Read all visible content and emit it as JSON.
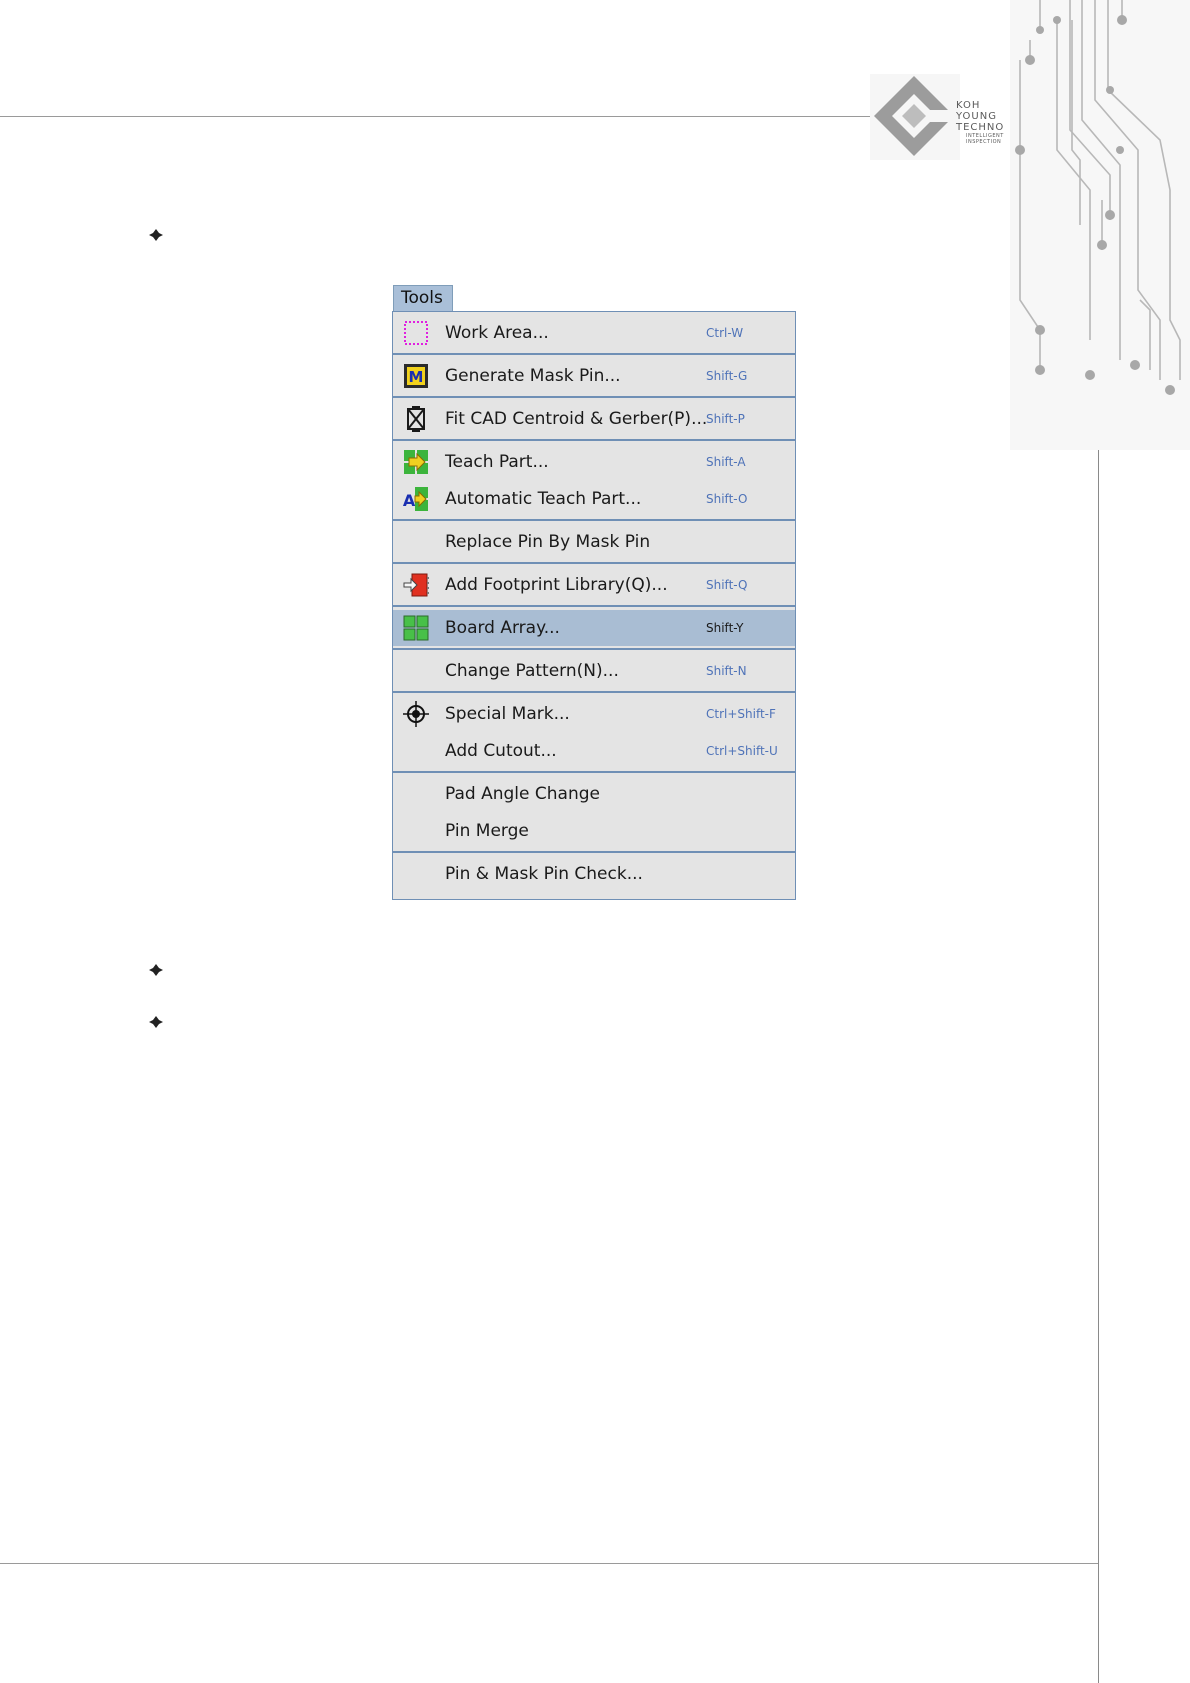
{
  "logo": {
    "line1": "KOH",
    "line2": "YOUNG",
    "line3": "TECHNO",
    "line4": "INTELLIGENT",
    "line5": "INSPECTION"
  },
  "menu": {
    "title": "Tools",
    "title_underline": "T",
    "items": [
      {
        "label": "Work Area...",
        "shortcut": "Ctrl-W",
        "icon": "work-area-icon"
      },
      {
        "label": "Generate Mask Pin...",
        "shortcut": "Shift-G",
        "icon": "mask-pin-icon"
      },
      {
        "label": "Fit CAD Centroid & Gerber(P)...",
        "shortcut": "Shift-P",
        "icon": "fit-cad-icon"
      },
      {
        "label": "Teach Part...",
        "shortcut": "Shift-A",
        "icon": "teach-part-icon"
      },
      {
        "label": "Automatic Teach Part...",
        "shortcut": "Shift-O",
        "icon": "auto-teach-icon"
      },
      {
        "label": "Replace Pin By Mask Pin",
        "shortcut": "",
        "icon": ""
      },
      {
        "label": "Add Footprint Library(Q)...",
        "shortcut": "Shift-Q",
        "icon": "footprint-library-icon"
      },
      {
        "label": "Board Array...",
        "shortcut": "Shift-Y",
        "icon": "board-array-icon",
        "highlighted": true
      },
      {
        "label": "Change Pattern(N)...",
        "shortcut": "Shift-N",
        "icon": ""
      },
      {
        "label": "Special Mark...",
        "shortcut": "Ctrl+Shift-F",
        "icon": "crosshair-icon"
      },
      {
        "label": "Add Cutout...",
        "shortcut": "Ctrl+Shift-U",
        "icon": ""
      },
      {
        "label": "Pad Angle Change",
        "shortcut": "",
        "icon": ""
      },
      {
        "label": "Pin Merge",
        "shortcut": "",
        "icon": ""
      },
      {
        "label": "Pin & Mask Pin Check...",
        "shortcut": "",
        "icon": ""
      }
    ]
  }
}
